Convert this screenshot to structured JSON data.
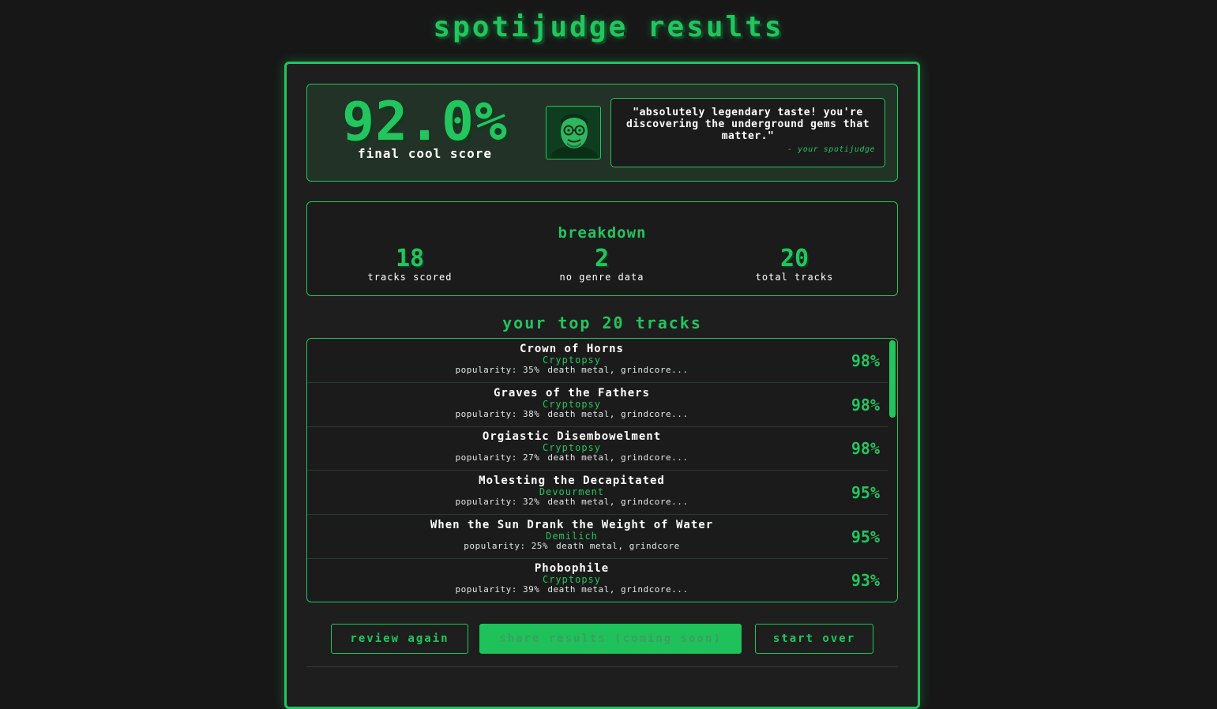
{
  "page_title": "spotijudge results",
  "score": {
    "value": "92.0%",
    "label": "final cool score"
  },
  "quote": {
    "text": "\"absolutely legendary taste! you're discovering the underground gems that matter.\"",
    "attribution": "- your spotijudge"
  },
  "breakdown": {
    "title": "breakdown",
    "stats": [
      {
        "value": "18",
        "label": "tracks scored"
      },
      {
        "value": "2",
        "label": "no genre data"
      },
      {
        "value": "20",
        "label": "total tracks"
      }
    ]
  },
  "tracks_heading": "your top 20 tracks",
  "tracks": [
    {
      "name": "Crown of Horns",
      "artist": "Cryptopsy",
      "popularity": "popularity: 35%",
      "genres": "death metal, grindcore...",
      "score": "98%"
    },
    {
      "name": "Graves of the Fathers",
      "artist": "Cryptopsy",
      "popularity": "popularity: 38%",
      "genres": "death metal, grindcore...",
      "score": "98%"
    },
    {
      "name": "Orgiastic Disembowelment",
      "artist": "Cryptopsy",
      "popularity": "popularity: 27%",
      "genres": "death metal, grindcore...",
      "score": "98%"
    },
    {
      "name": "Molesting the Decapitated",
      "artist": "Devourment",
      "popularity": "popularity: 32%",
      "genres": "death metal, grindcore...",
      "score": "95%"
    },
    {
      "name": "When the Sun Drank the Weight of Water",
      "artist": "Demilich",
      "popularity": "popularity: 25%",
      "genres": "death metal, grindcore",
      "score": "95%"
    },
    {
      "name": "Phobophile",
      "artist": "Cryptopsy",
      "popularity": "popularity: 39%",
      "genres": "death metal, grindcore...",
      "score": "93%"
    }
  ],
  "buttons": {
    "review_again": "review again",
    "share_results": "share results (coming soon)",
    "start_over": "start over"
  },
  "colors": {
    "accent": "#22c55e",
    "background": "#171717",
    "panel": "#1e1e1e"
  }
}
